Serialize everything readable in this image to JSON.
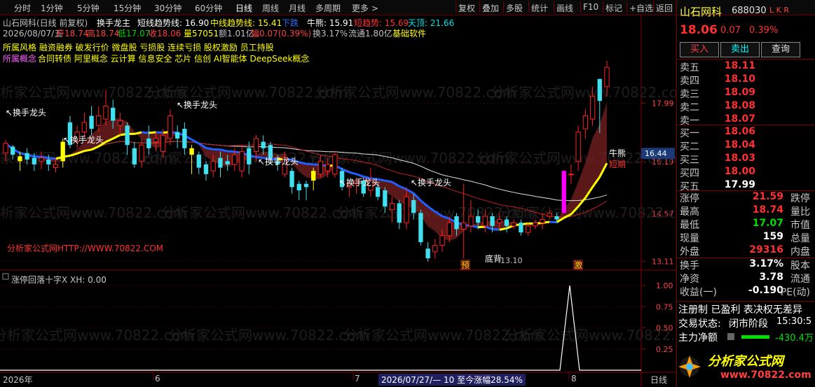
{
  "toolbar": {
    "left": [
      "分时",
      "1分钟",
      "5分钟",
      "15分钟",
      "30分钟",
      "60分钟",
      "日线",
      "周线",
      "月线",
      "多周期",
      "更多 >"
    ],
    "selected": "日线",
    "right": [
      "复权",
      "叠加",
      "多股",
      "统计",
      "画线",
      "F10",
      "标记",
      "+自选",
      "返回"
    ]
  },
  "header": {
    "stock_title": "山石网科(日线 前复权)",
    "indicator_name": "换手龙主",
    "trend_short": "短线趋势线: 16.90",
    "trend_mid": "中线趋势线: 15.41",
    "down_label": "下跌",
    "bear_label": "牛熊: 15.91",
    "short_trend_label": "短趋势: 15.69",
    "top_label": "天顶: 21.66",
    "bar_date": "2026/08/07/五",
    "open": "开18.74",
    "high": "高18.74",
    "low": "低17.07",
    "close": "收18.06",
    "volume": "量57051",
    "amount": "额1.01亿",
    "change": "幅0.07(0.39%)",
    "turnover": "换3.17%",
    "float": "流通1.80亿",
    "sector": "基础软件",
    "style_line": "所属风格 融资融券 破发行价 微盘股 亏损股 连续亏损 股权激励 员工持股",
    "concept_label": "所属概念",
    "concept_line": "合同转债 阿里概念 云计算 信息安全 芯片 信创 AI智能体 DeepSeek概念",
    "watermark_link": "分析家公式网HTTP://WWW.70822.COM",
    "watermark": "分析家公式网www.70822.com"
  },
  "annotations": {
    "hand_dragon": "换手龙头",
    "bear_tag": "牛熊",
    "short_tag": "短期",
    "pre_tag": "预",
    "burst_tag": "激",
    "bottom_tag": "底背",
    "low_price": "13.10",
    "current_price_tag": "16.44"
  },
  "price_axis": [
    "17.99",
    "16.19",
    "14.57",
    "13.11"
  ],
  "sub_indicator": {
    "title": "涨停回落十字X XH: 0.00",
    "axis": [
      "1.00",
      "0.75",
      "0.50",
      "0.25"
    ]
  },
  "time_axis": {
    "labels": [
      "2026年",
      "6",
      "7",
      "8"
    ],
    "range_info": "2026/07/27/— 10 至今涨幅28.54%",
    "period": "日线"
  },
  "quote": {
    "name": "山石网科",
    "code": "688030",
    "flags": "L K R",
    "price": "18.06",
    "change": "0.07",
    "pct": "0.39%",
    "buttons": [
      "买入",
      "卖出",
      "查询"
    ],
    "sell": [
      [
        "卖五",
        "18.11"
      ],
      [
        "卖四",
        "18.10"
      ],
      [
        "卖三",
        "18.09"
      ],
      [
        "卖二",
        "18.08"
      ],
      [
        "卖一",
        "18.07"
      ]
    ],
    "buy": [
      [
        "买一",
        "18.06"
      ],
      [
        "买二",
        "18.04"
      ],
      [
        "买三",
        "18.03"
      ],
      [
        "买四",
        "18.00"
      ],
      [
        "买五",
        "17.99"
      ]
    ],
    "stats": [
      [
        "涨停",
        "21.59",
        "跌停"
      ],
      [
        "最高",
        "18.74",
        "量比"
      ],
      [
        "最低",
        "17.07",
        "市值"
      ],
      [
        "现量",
        "159",
        "总量"
      ],
      [
        "外盘",
        "29316",
        "内盘"
      ]
    ],
    "fund": [
      [
        "换手",
        "3.17%",
        "股本"
      ],
      [
        "净资",
        "3.78",
        "流通"
      ],
      [
        "收益(一)",
        "-0.190",
        "PE(动)"
      ]
    ],
    "reg_line": "注册制 已盈利 表决权无差异",
    "status_label": "交易状态:",
    "status_value": "闭市阶段",
    "status_time": "15:30:5",
    "net_label": "主力净额",
    "net_value": "-430.4万",
    "logo_text": "分析家公式网",
    "logo_url": "www.70822.com"
  },
  "chart_data": {
    "type": "candlestick",
    "y_range": [
      12.9,
      19.6
    ],
    "candles": [
      [
        16.45,
        16.75,
        16.2,
        16.85
      ],
      [
        16.65,
        16.4,
        16.25,
        16.7
      ],
      [
        16.35,
        16.2,
        15.9,
        16.5
      ],
      [
        16.45,
        16.25,
        16.1,
        16.6
      ],
      [
        16.3,
        16.1,
        15.9,
        16.45
      ],
      [
        16.2,
        16.3,
        15.95,
        16.5
      ],
      [
        16.25,
        16.1,
        15.9,
        16.4
      ],
      [
        16.0,
        16.1,
        15.85,
        16.3
      ],
      [
        16.2,
        16.8,
        16.0,
        16.9
      ],
      [
        17.4,
        16.7,
        16.6,
        17.6
      ],
      [
        16.8,
        17.1,
        16.6,
        17.3
      ],
      [
        17.1,
        17.4,
        16.9,
        17.7
      ],
      [
        17.6,
        17.2,
        17.0,
        17.9
      ],
      [
        17.3,
        17.6,
        17.1,
        17.9
      ],
      [
        17.5,
        17.9,
        17.3,
        18.4
      ],
      [
        17.85,
        17.45,
        17.2,
        18.1
      ],
      [
        17.3,
        17.45,
        17.0,
        17.7
      ],
      [
        17.3,
        16.7,
        16.4,
        17.4
      ],
      [
        16.6,
        16.1,
        16.0,
        16.8
      ],
      [
        16.2,
        16.7,
        16.0,
        16.9
      ],
      [
        16.9,
        16.6,
        16.4,
        17.3
      ],
      [
        16.8,
        16.9,
        16.5,
        17.1
      ],
      [
        16.5,
        17.0,
        16.3,
        17.2
      ],
      [
        16.9,
        17.6,
        16.7,
        17.8
      ],
      [
        17.1,
        16.9,
        16.6,
        17.3
      ],
      [
        17.2,
        16.6,
        16.4,
        17.4
      ],
      [
        16.6,
        16.4,
        15.8,
        16.7
      ],
      [
        16.4,
        16.0,
        15.8,
        16.5
      ],
      [
        16.1,
        15.8,
        15.6,
        16.2
      ],
      [
        15.9,
        16.2,
        15.7,
        16.4
      ],
      [
        16.3,
        16.0,
        15.7,
        16.5
      ],
      [
        16.2,
        16.1,
        15.9,
        16.4
      ],
      [
        16.1,
        16.4,
        15.9,
        16.6
      ],
      [
        15.9,
        16.5,
        15.7,
        16.7
      ],
      [
        16.6,
        16.1,
        15.8,
        16.8
      ],
      [
        16.5,
        16.9,
        16.2,
        17.0
      ],
      [
        16.8,
        16.6,
        16.4,
        17.0
      ],
      [
        16.7,
        16.3,
        16.1,
        16.8
      ],
      [
        16.2,
        16.1,
        15.9,
        16.4
      ],
      [
        15.8,
        16.3,
        15.7,
        16.5
      ],
      [
        15.9,
        15.4,
        15.2,
        16.0
      ],
      [
        15.5,
        15.3,
        15.0,
        15.6
      ],
      [
        15.5,
        15.4,
        15.0,
        15.6
      ],
      [
        15.6,
        15.9,
        15.3,
        16.0
      ],
      [
        15.8,
        16.2,
        15.7,
        16.4
      ],
      [
        15.9,
        16.1,
        15.7,
        16.3
      ],
      [
        15.8,
        16.4,
        15.7,
        16.5
      ],
      [
        15.9,
        15.4,
        15.3,
        16.0
      ],
      [
        15.4,
        15.5,
        15.1,
        15.6
      ],
      [
        15.5,
        15.6,
        15.2,
        15.7
      ],
      [
        15.6,
        15.2,
        15.1,
        15.7
      ],
      [
        15.3,
        15.6,
        15.1,
        16.0
      ],
      [
        15.4,
        15.1,
        15.0,
        15.5
      ],
      [
        15.3,
        14.8,
        14.6,
        15.4
      ],
      [
        14.7,
        14.9,
        14.3,
        15.1
      ],
      [
        14.9,
        14.3,
        14.1,
        15.0
      ],
      [
        14.3,
        15.1,
        14.1,
        15.4
      ],
      [
        15.0,
        14.6,
        14.4,
        15.2
      ],
      [
        14.6,
        13.7,
        13.6,
        14.7
      ],
      [
        13.5,
        13.2,
        13.1,
        13.7
      ],
      [
        13.4,
        13.6,
        13.2,
        13.8
      ],
      [
        13.6,
        13.9,
        13.4,
        14.1
      ],
      [
        13.9,
        14.3,
        13.7,
        14.5
      ],
      [
        14.5,
        14.1,
        13.9,
        14.6
      ],
      [
        14.1,
        14.3,
        13.2,
        15.5
      ],
      [
        14.2,
        14.5,
        14.0,
        15.0
      ],
      [
        14.5,
        14.3,
        14.1,
        14.7
      ],
      [
        14.2,
        14.5,
        14.0,
        14.7
      ],
      [
        14.5,
        14.2,
        14.0,
        14.6
      ],
      [
        14.3,
        14.4,
        14.1,
        14.6
      ],
      [
        14.4,
        14.2,
        14.0,
        14.5
      ],
      [
        14.2,
        14.3,
        14.1,
        14.4
      ],
      [
        14.3,
        14.0,
        13.9,
        14.4
      ],
      [
        14.0,
        14.2,
        13.9,
        14.3
      ],
      [
        14.2,
        14.3,
        14.1,
        14.4
      ],
      [
        14.3,
        14.4,
        14.1,
        14.6
      ],
      [
        14.5,
        14.6,
        14.4,
        14.7
      ],
      [
        14.5,
        14.4,
        14.3,
        14.6
      ],
      [
        14.6,
        15.9,
        14.6,
        15.9
      ],
      [
        15.8,
        15.8,
        15.5,
        16.1
      ],
      [
        16.2,
        17.1,
        15.9,
        17.3
      ],
      [
        17.2,
        17.6,
        16.9,
        17.8
      ],
      [
        17.5,
        18.2,
        17.3,
        18.5
      ],
      [
        18.74,
        18.06,
        17.07,
        18.74
      ],
      [
        18.5,
        19.1,
        18.2,
        19.3
      ]
    ]
  }
}
